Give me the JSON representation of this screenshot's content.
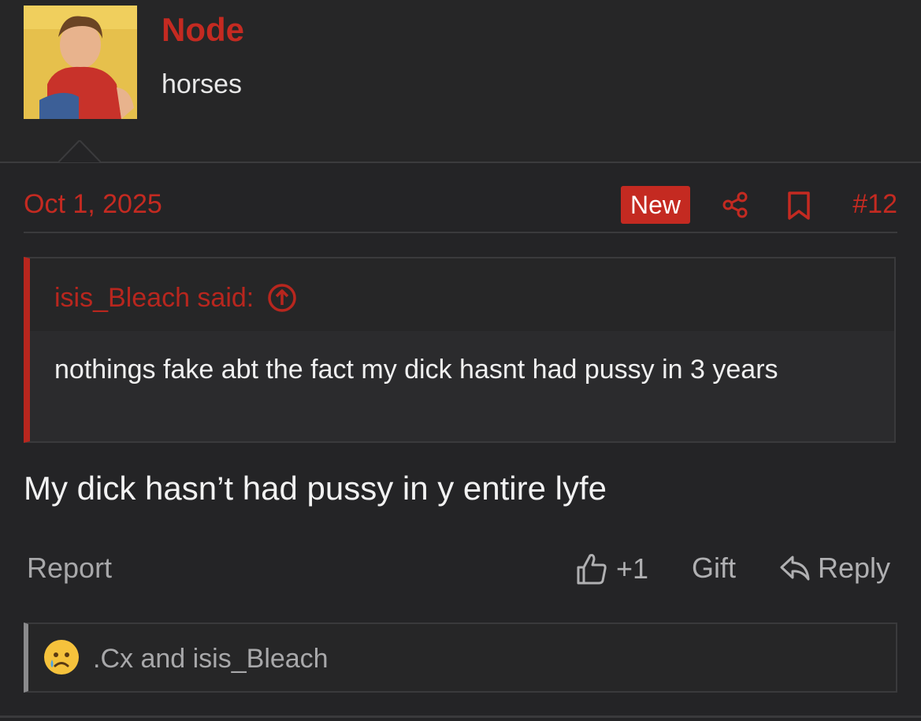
{
  "user": {
    "name": "Node",
    "title": "horses"
  },
  "post": {
    "date": "Oct 1, 2025",
    "badge": "New",
    "number": "#12",
    "quote": {
      "attribution": "isis_Bleach said:",
      "text": "nothings fake abt the fact my dick hasnt had pussy in 3 years"
    },
    "body": "My dick hasn’t had pussy in y entire lyfe"
  },
  "actions": {
    "report": "Report",
    "like": "+1",
    "gift": "Gift",
    "reply": "Reply"
  },
  "reactions": {
    "users": ".Cx and isis_Bleach"
  },
  "icons": [
    "share-icon",
    "bookmark-icon",
    "arrow-up-icon",
    "thumbs-up-icon",
    "reply-icon",
    "sad-face-icon"
  ],
  "colors": {
    "accent": "#c42a21",
    "background": "#242426"
  }
}
